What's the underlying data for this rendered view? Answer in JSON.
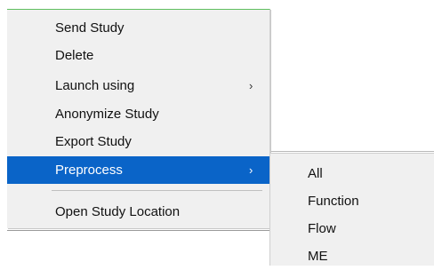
{
  "context_menu": {
    "items": [
      {
        "label": "Send Study"
      },
      {
        "label": "Delete"
      },
      {
        "label": "Launch using",
        "submenu_arrow": "›"
      },
      {
        "label": "Anonymize Study"
      },
      {
        "label": "Export Study"
      },
      {
        "label": "Preprocess",
        "submenu_arrow": "›",
        "highlighted": true
      },
      {
        "label": "Open Study Location"
      }
    ]
  },
  "submenu": {
    "items": [
      {
        "label": "All"
      },
      {
        "label": "Function"
      },
      {
        "label": "Flow"
      },
      {
        "label": "ME"
      }
    ]
  },
  "colors": {
    "highlight": "#0a64c8",
    "menu_background": "#f0f0f0",
    "accent_border": "#5fbf5f"
  }
}
